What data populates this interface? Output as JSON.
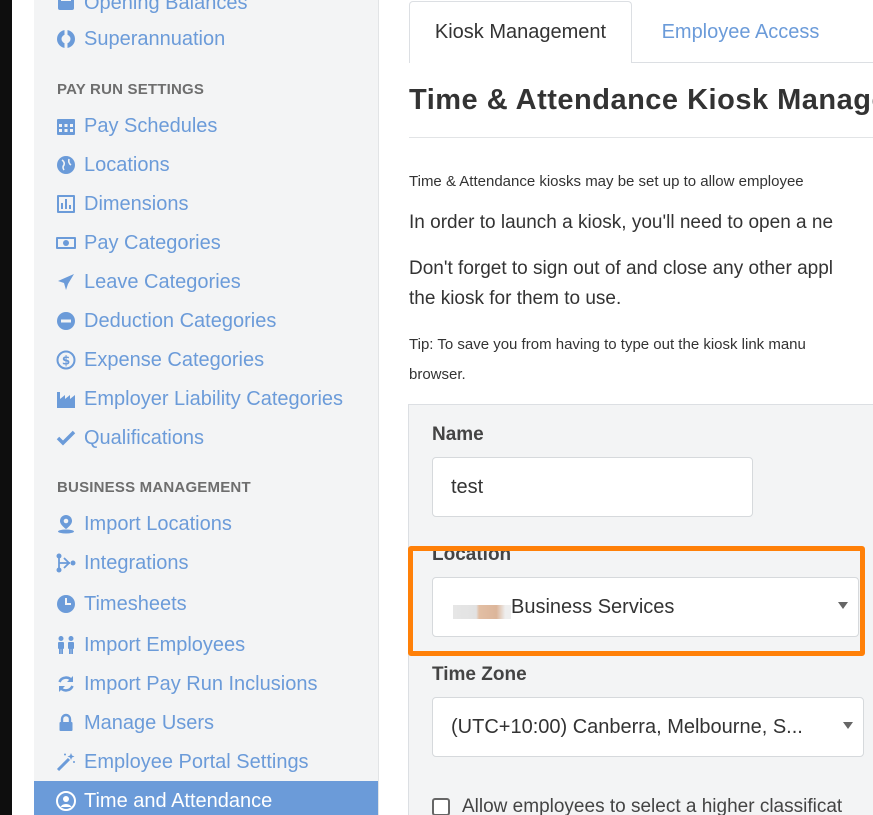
{
  "sidebar": {
    "items": [
      {
        "label": "Opening Balances",
        "icon": "opening-balances-icon"
      },
      {
        "label": "Superannuation",
        "icon": "lifebuoy-icon"
      },
      {
        "label": "Pay Schedules",
        "icon": "calendar-icon"
      },
      {
        "label": "Locations",
        "icon": "globe-icon"
      },
      {
        "label": "Dimensions",
        "icon": "bar-chart-icon"
      },
      {
        "label": "Pay Categories",
        "icon": "money-icon"
      },
      {
        "label": "Leave Categories",
        "icon": "plane-icon"
      },
      {
        "label": "Deduction Categories",
        "icon": "minus-circle-icon"
      },
      {
        "label": "Expense Categories",
        "icon": "dollar-refresh-icon"
      },
      {
        "label": "Employer Liability Categories",
        "icon": "industry-icon"
      },
      {
        "label": "Qualifications",
        "icon": "check-icon"
      },
      {
        "label": "Import Locations",
        "icon": "map-pin-icon"
      },
      {
        "label": "Integrations",
        "icon": "integrations-icon"
      },
      {
        "label": "Timesheets",
        "icon": "clock-icon"
      },
      {
        "label": "Import Employees",
        "icon": "users-icon"
      },
      {
        "label": "Import Pay Run Inclusions",
        "icon": "refresh-icon"
      },
      {
        "label": "Manage Users",
        "icon": "lock-icon"
      },
      {
        "label": "Employee Portal Settings",
        "icon": "magic-wand-icon"
      },
      {
        "label": "Time and Attendance",
        "icon": "user-circle-icon"
      }
    ],
    "headings": [
      "PAY RUN SETTINGS",
      "BUSINESS MANAGEMENT"
    ]
  },
  "tabs": [
    "Kiosk Management",
    "Employee Access"
  ],
  "main": {
    "title": "Time & Attendance Kiosk Manage",
    "intro": "Time & Attendance kiosks may be set up to allow employee",
    "launch": "In order to launch a kiosk, you'll need to open a ne",
    "signout_line1": "Don't forget to sign out of and close any other appl",
    "signout_line2": "the kiosk for them to use.",
    "tip_line1": "Tip: To save you from having to type out the kiosk link manu",
    "tip_line2": "browser."
  },
  "form": {
    "name_label": "Name",
    "name_value": "test",
    "location_label": "Location",
    "location_value": "Business Services",
    "timezone_label": "Time Zone",
    "timezone_value": "(UTC+10:00) Canberra, Melbourne, S...",
    "allow_label": "Allow employees to select a higher classificat"
  },
  "colors": {
    "link": "#6b9bd9",
    "highlight": "#ff8008",
    "sidebar_bg": "#f3f4f5"
  }
}
